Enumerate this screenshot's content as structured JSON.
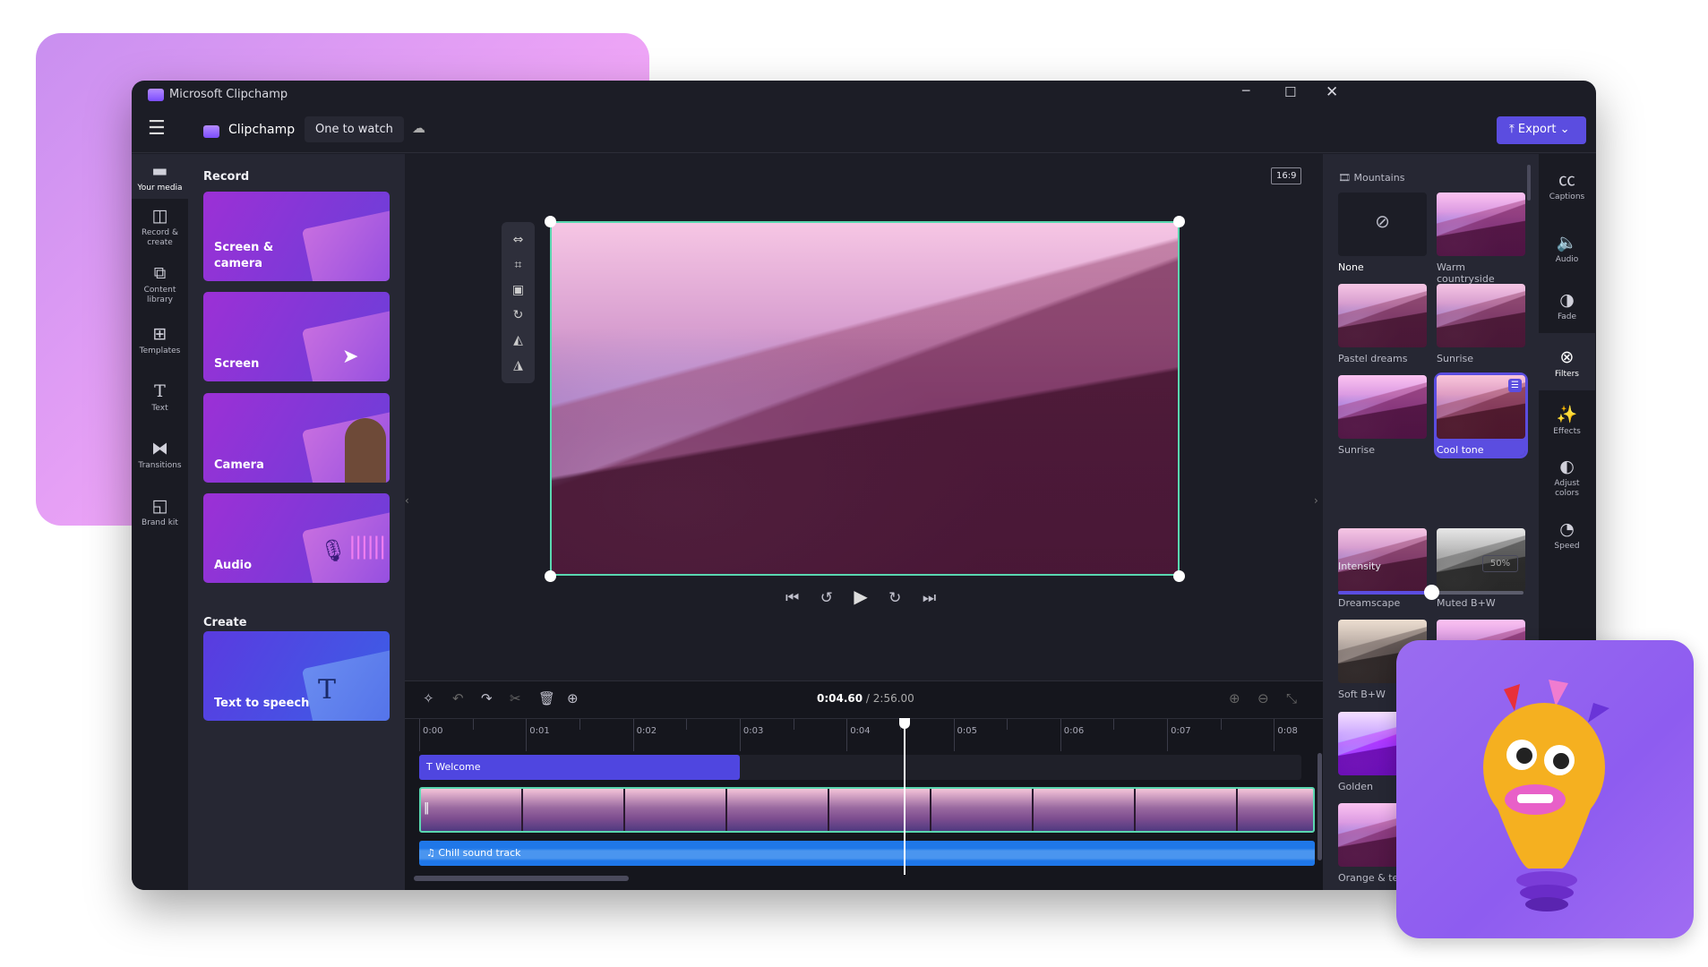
{
  "window": {
    "title": "Microsoft Clipchamp",
    "controls": [
      "minimize",
      "maximize",
      "close"
    ]
  },
  "toolbar": {
    "app_name": "Clipchamp",
    "project_name": "One to watch",
    "export_label": "Export"
  },
  "left_rail": [
    {
      "label": "Your media",
      "icon": "folder-icon"
    },
    {
      "label": "Record & create",
      "icon": "camera-icon"
    },
    {
      "label": "Content library",
      "icon": "library-icon"
    },
    {
      "label": "Templates",
      "icon": "templates-icon"
    },
    {
      "label": "Text",
      "icon": "text-icon"
    },
    {
      "label": "Transitions",
      "icon": "transitions-icon"
    },
    {
      "label": "Brand kit",
      "icon": "brand-kit-icon"
    }
  ],
  "media_panel": {
    "record_heading": "Record",
    "record_cards": [
      "Screen & camera",
      "Screen",
      "Camera",
      "Audio"
    ],
    "create_heading": "Create",
    "create_cards": [
      "Text to speech"
    ]
  },
  "preview": {
    "aspect_ratio": "16:9"
  },
  "timeline": {
    "current_time": "0:04.60",
    "total_time": "2:56.00",
    "ticks": [
      "0:00",
      "0:01",
      "0:02",
      "0:03",
      "0:04",
      "0:05",
      "0:06",
      "0:07",
      "0:08"
    ],
    "playhead_seconds": 4.6,
    "text_clip": "Welcome",
    "audio_clip": "Chill sound track"
  },
  "filters": {
    "section": "Mountains",
    "items": [
      "None",
      "Warm countryside",
      "Pastel dreams",
      "Sunrise",
      "Sunrise",
      "Cool tone",
      "Dreamscape",
      "Muted B+W",
      "Soft B+W",
      "",
      "Golden",
      "",
      "Orange & te"
    ],
    "selected": "Cool tone",
    "intensity_label": "Intensity",
    "intensity_value": "50%",
    "intensity_fraction": 0.5
  },
  "right_rail": [
    {
      "label": "Captions",
      "icon": "captions-icon"
    },
    {
      "label": "Audio",
      "icon": "speaker-icon"
    },
    {
      "label": "Fade",
      "icon": "fade-icon"
    },
    {
      "label": "Filters",
      "icon": "filters-icon"
    },
    {
      "label": "Effects",
      "icon": "magic-wand-icon"
    },
    {
      "label": "Adjust colors",
      "icon": "adjust-colors-icon"
    },
    {
      "label": "Speed",
      "icon": "speedometer-icon"
    }
  ],
  "colors": {
    "accent": "#5b4de0",
    "selection": "#5ad7b0",
    "audio": "#1f77e8",
    "text_clip": "#4f46e0"
  }
}
